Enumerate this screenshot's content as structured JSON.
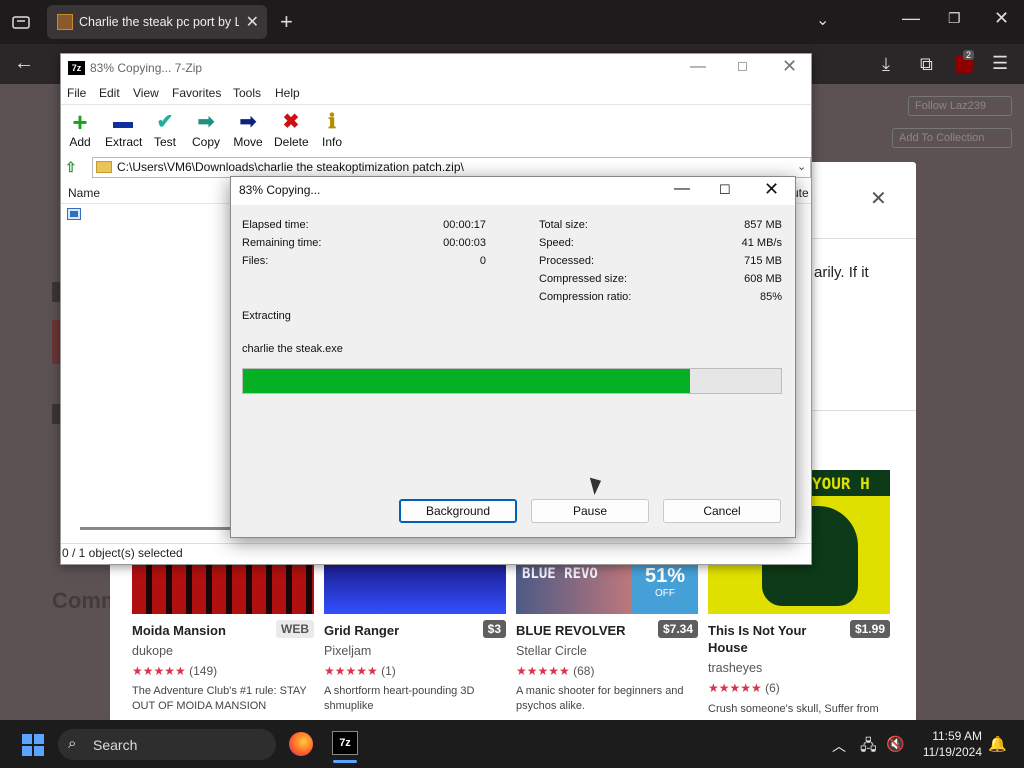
{
  "browser": {
    "tab_title": "Charlie the steak pc port by Laz",
    "new_tab_glyph": "+",
    "extension_badge": "2"
  },
  "page": {
    "follow_label": "Follow Laz239",
    "collection_label": "Add To Collection",
    "modal_text": "arily. If it",
    "comments_heading": "Comm",
    "games": [
      {
        "name": "Moida Mansion",
        "price": "WEB",
        "author": "dukope",
        "stars": "★★★★★",
        "rating_count": "(149)",
        "desc": "The Adventure Club's #1 rule: STAY OUT OF MOIDA MANSION"
      },
      {
        "name": "Grid Ranger",
        "price": "$3",
        "author": "Pixeljam",
        "stars": "★★★★★",
        "rating_count": "(1)",
        "desc": "A shortform heart-pounding 3D shmuplike"
      },
      {
        "name": "BLUE REVOLVER",
        "price": "$7.34",
        "author": "Stellar Circle",
        "stars": "★★★★★",
        "rating_count": "(68)",
        "desc": "A manic shooter for beginners and psychos alike.",
        "sale_pct": "51%",
        "sale_off": "OFF",
        "art_text": "BLUE REVO"
      },
      {
        "name": "This Is Not Your House",
        "price": "$1.99",
        "author": "trasheyes",
        "stars": "★★★★★",
        "rating_count": "(6)",
        "desc": "Crush someone's skull, Suffer from",
        "art_text": "YOUR H"
      }
    ]
  },
  "zip": {
    "title": "83% Copying... 7-Zip",
    "logo": "7z",
    "menu": [
      "File",
      "Edit",
      "View",
      "Favorites",
      "Tools",
      "Help"
    ],
    "toolbar": [
      {
        "label": "Add",
        "icon": "+",
        "color": "#1aa01a"
      },
      {
        "label": "Extract",
        "icon": "▬",
        "color": "#1030a0"
      },
      {
        "label": "Test",
        "icon": "✔",
        "color": "#20b0a0"
      },
      {
        "label": "Copy",
        "icon": "➡",
        "color": "#209080"
      },
      {
        "label": "Move",
        "icon": "➡",
        "color": "#102080"
      },
      {
        "label": "Delete",
        "icon": "✖",
        "color": "#d01010"
      },
      {
        "label": "Info",
        "icon": "ℹ",
        "color": "#b09000"
      }
    ],
    "address": "C:\\Users\\VM6\\Downloads\\charlie the steakoptimization patch.zip\\",
    "column_name": "Name",
    "column_partial": "ute",
    "status": "0 / 1 object(s) selected"
  },
  "dialog": {
    "title": "83% Copying...",
    "left_stats": [
      {
        "label": "Elapsed time:",
        "value": "00:00:17"
      },
      {
        "label": "Remaining time:",
        "value": "00:00:03"
      },
      {
        "label": "Files:",
        "value": "0"
      }
    ],
    "right_stats": [
      {
        "label": "Total size:",
        "value": "857 MB"
      },
      {
        "label": "Speed:",
        "value": "41 MB/s"
      },
      {
        "label": "Processed:",
        "value": "715 MB"
      },
      {
        "label": "Compressed size:",
        "value": "608 MB"
      },
      {
        "label": "Compression ratio:",
        "value": "85%"
      }
    ],
    "action": "Extracting",
    "current_file": "charlie the steak.exe",
    "progress": 0.83,
    "buttons": {
      "background": "Background",
      "pause": "Pause",
      "cancel": "Cancel"
    }
  },
  "taskbar": {
    "search_label": "Search",
    "zip_label": "7z",
    "time": "11:59 AM",
    "date": "11/19/2024"
  }
}
